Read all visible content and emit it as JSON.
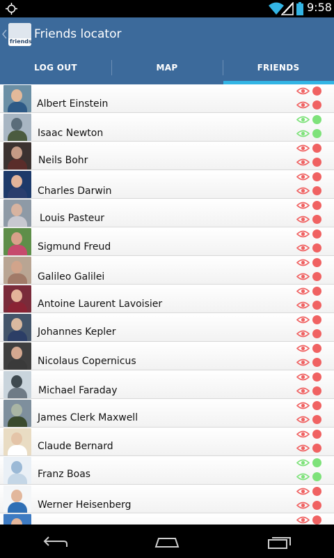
{
  "status_bar": {
    "time": "9:58"
  },
  "action_bar": {
    "title": "Friends locator",
    "logo_text": "friends"
  },
  "tabs": [
    {
      "label": "LOG OUT"
    },
    {
      "label": "MAP"
    },
    {
      "label": "FRIENDS"
    }
  ],
  "colors": {
    "accent": "#33b5e5",
    "bar": "#3c6a9b",
    "red": "#f06262",
    "green": "#7ee27a"
  },
  "friends": [
    {
      "name": "Albert Einstein",
      "status": "red"
    },
    {
      "name": "Isaac Newton",
      "status": "green"
    },
    {
      "name": "Neils Bohr",
      "status": "red"
    },
    {
      "name": "Charles Darwin",
      "status": "red"
    },
    {
      "name": "Louis Pasteur",
      "status": "red"
    },
    {
      "name": "Sigmund Freud",
      "status": "red"
    },
    {
      "name": "Galileo Galilei",
      "status": "red"
    },
    {
      "name": "Antoine Laurent Lavoisier",
      "status": "red"
    },
    {
      "name": "Johannes Kepler",
      "status": "red"
    },
    {
      "name": "Nicolaus Copernicus",
      "status": "red"
    },
    {
      "name": "Michael Faraday",
      "status": "red"
    },
    {
      "name": "James Clerk Maxwell",
      "status": "red"
    },
    {
      "name": "Claude Bernard",
      "status": "red"
    },
    {
      "name": "Franz Boas",
      "status": "green"
    },
    {
      "name": "Werner Heisenberg",
      "status": "red"
    },
    {
      "name": "",
      "status": "red"
    }
  ]
}
